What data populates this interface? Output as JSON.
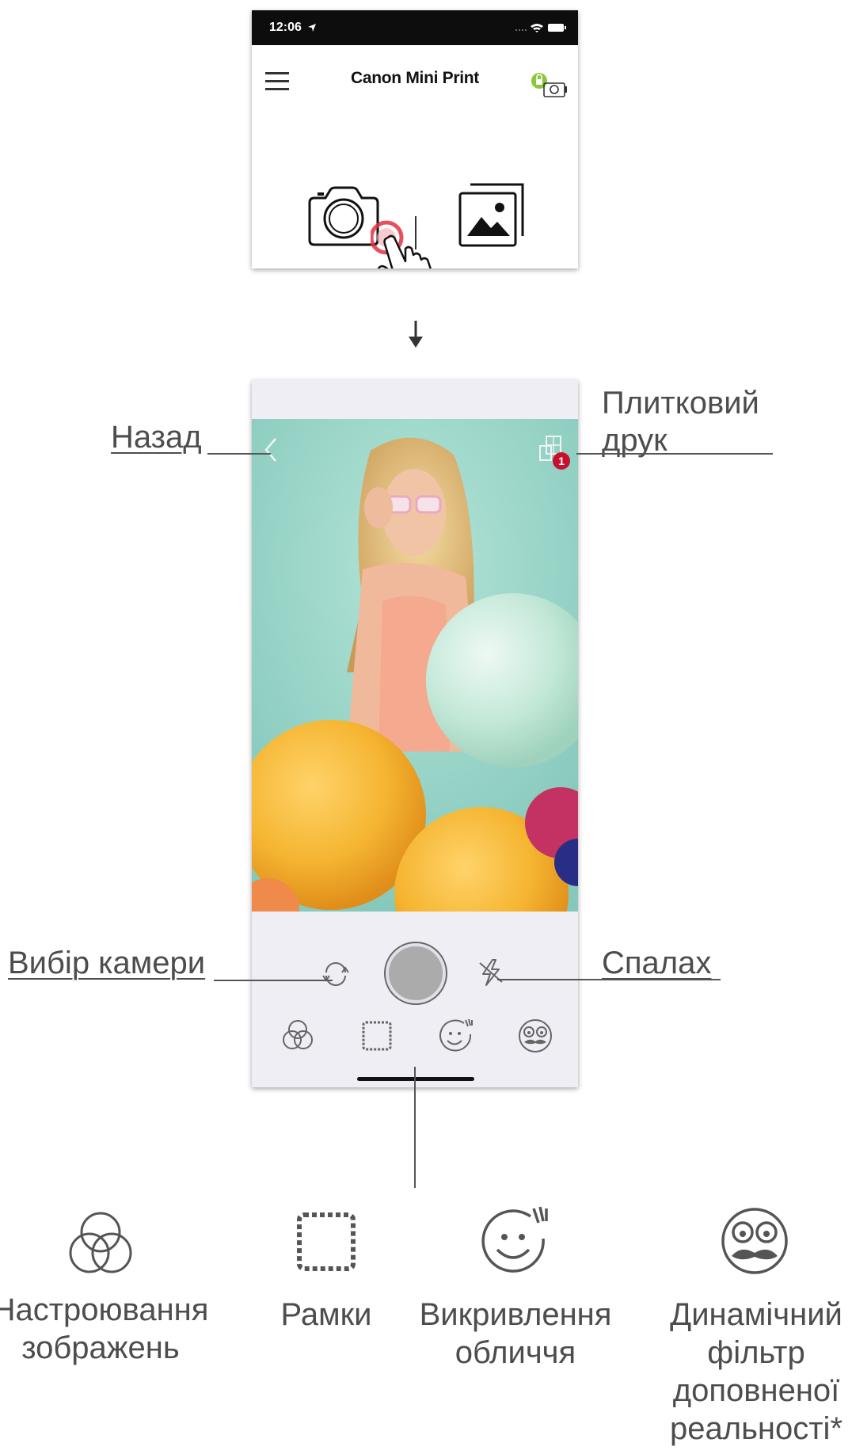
{
  "top_screen": {
    "status_time": "12:06",
    "title": "Canon Mini Print"
  },
  "camera_screen": {},
  "callouts": {
    "back": "Назад",
    "tile_print_line1": "Плитковий",
    "tile_print_line2": "друк",
    "camera_select": "Вибір камери",
    "flash": "Спалах",
    "tile_badge": "1"
  },
  "features": [
    {
      "icon": "overlapping-circles-icon",
      "lines": [
        "Настроювання",
        "зображень"
      ]
    },
    {
      "icon": "frame-icon",
      "lines": [
        "Рамки"
      ]
    },
    {
      "icon": "face-warp-icon",
      "lines": [
        "Викривлення",
        "обличчя"
      ]
    },
    {
      "icon": "mustache-face-icon",
      "lines": [
        "Динамічний",
        "фільтр",
        "доповненої",
        "реальності*"
      ]
    }
  ],
  "colors": {
    "accent_red": "#e0333f",
    "text_gray": "#4d4d4d",
    "photo_background": "#9bd6cb",
    "balloon_yellow": "#f5b531",
    "balloon_mint": "#bfe6d6"
  }
}
